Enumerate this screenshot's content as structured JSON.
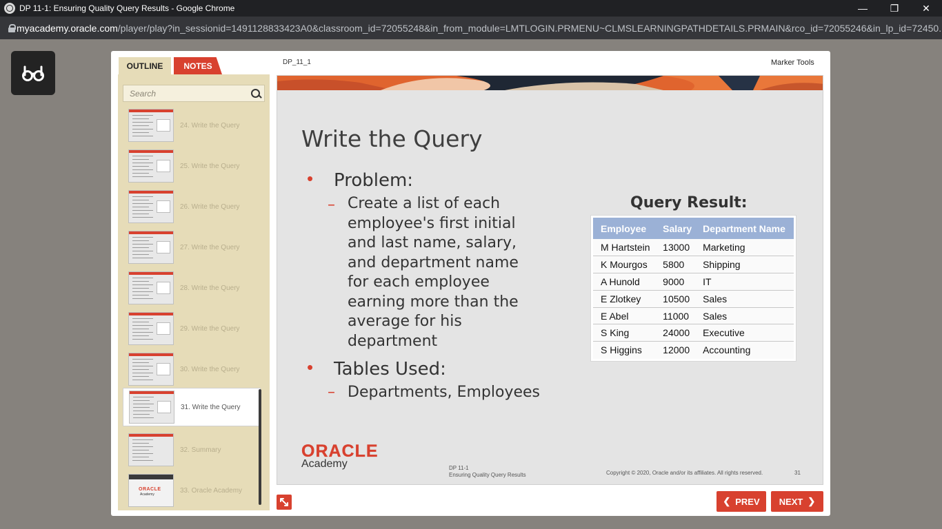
{
  "browser": {
    "window_title": "DP 11-1: Ensuring Quality Query Results - Google Chrome",
    "url_host": "myacademy.oracle.com",
    "url_path": "/player/play?in_sessionid=1491128833423A0&classroom_id=72055248&in_from_module=LMTLOGIN.PRMENU~CLMSLEARNINGPATHDETAILS.PRMAIN&rco_id=72055246&in_lp_id=72450..."
  },
  "player": {
    "tabs": {
      "outline": "OUTLINE",
      "notes": "NOTES"
    },
    "search_placeholder": "Search",
    "slide_id": "DP_11_1",
    "marker_tools": "Marker Tools",
    "prev_label": "PREV",
    "next_label": "NEXT",
    "outline": [
      {
        "label": "24. Write the Query"
      },
      {
        "label": "25. Write the Query"
      },
      {
        "label": "26. Write the Query"
      },
      {
        "label": "27. Write the Query"
      },
      {
        "label": "28. Write the Query"
      },
      {
        "label": "29. Write the Query"
      },
      {
        "label": "30. Write the Query"
      },
      {
        "label": "31. Write the Query"
      },
      {
        "label": "32. Summary"
      },
      {
        "label": "33. Oracle Academy"
      }
    ],
    "active_outline_index": 7,
    "thumb_logo": "ORACLE",
    "thumb_logo_sub": "Academy"
  },
  "slide": {
    "title": "Write the Query",
    "problem_heading": "Problem:",
    "problem_lines": [
      "Create a list of each",
      "employee's first initial",
      "and last name, salary,",
      "and department name",
      "for each employee",
      "earning more than the",
      "average for his",
      "department"
    ],
    "tables_heading": "Tables Used:",
    "tables_text": "Departments, Employees",
    "query_result_title": "Query Result:",
    "query_table": {
      "headers": [
        "Employee",
        "Salary",
        "Department Name"
      ],
      "rows": [
        [
          "M Hartstein",
          "13000",
          "Marketing"
        ],
        [
          "K Mourgos",
          "5800",
          "Shipping"
        ],
        [
          "A Hunold",
          "9000",
          "IT"
        ],
        [
          "E Zlotkey",
          "10500",
          "Sales"
        ],
        [
          "E Abel",
          "11000",
          "Sales"
        ],
        [
          "S King",
          "24000",
          "Executive"
        ],
        [
          "S Higgins",
          "12000",
          "Accounting"
        ]
      ]
    },
    "logo": "ORACLE",
    "logo_sub": "Academy",
    "footer_line1": "DP 11-1",
    "footer_line2": "Ensuring Quality Query Results",
    "copyright": "Copyright © 2020, Oracle and/or its affiliates. All rights reserved.",
    "page_number": "31"
  },
  "colors": {
    "accent": "#d8412f",
    "table_header": "#9bb1d6",
    "sidebar": "#e6dcb8"
  }
}
